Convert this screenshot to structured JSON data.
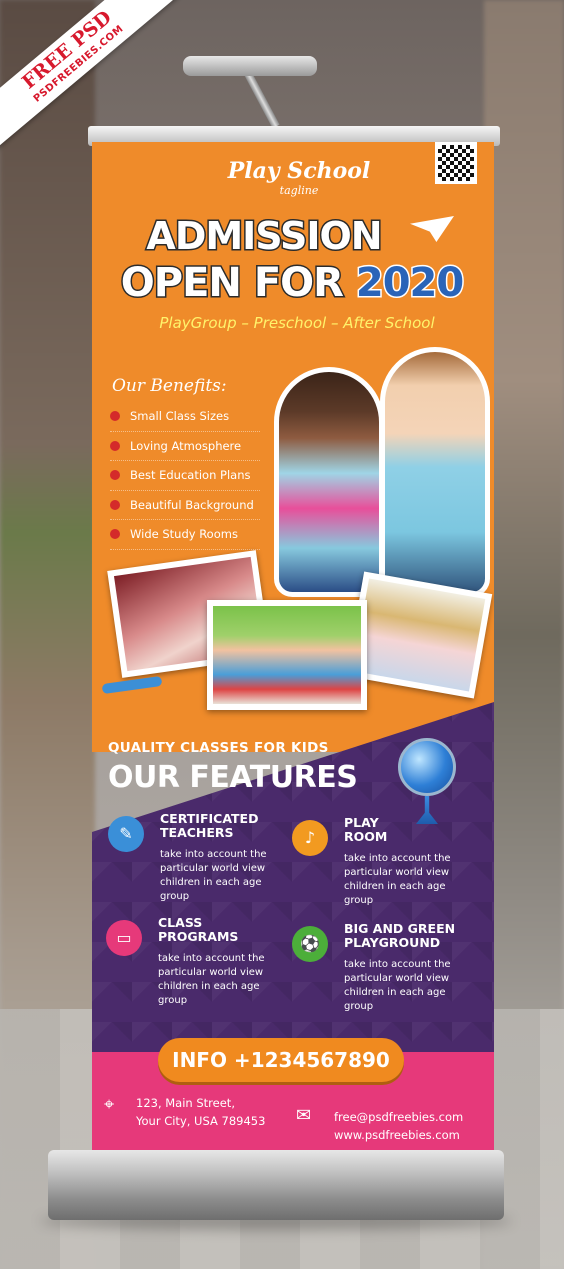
{
  "badge": {
    "title": "FREE PSD",
    "subtitle": "PSDFREEBIES.COM"
  },
  "brand": {
    "name": "Play School",
    "tagline": "tagline"
  },
  "headline": {
    "line1": "ADMISSION",
    "line2_a": "OPEN FOR",
    "line2_b": "2020"
  },
  "programs": "PlayGroup  –  Preschool  –  After School",
  "benefits": {
    "title": "Our Benefits:",
    "items": [
      "Small Class Sizes",
      "Loving Atmosphere",
      "Best Education Plans",
      "Beautiful Background",
      "Wide Study Rooms"
    ]
  },
  "features": {
    "kicker": "QUALITY CLASSES FOR KIDS",
    "title": "OUR FEATURES",
    "items": [
      {
        "title": "CERTIFICATED\nTEACHERS",
        "desc": "take into account the particular world view children in each age group",
        "icon": "pencil-icon",
        "color": "#3a8fd8"
      },
      {
        "title": "PLAY\nROOM",
        "desc": "take into account the particular world view children in each age group",
        "icon": "drum-icon",
        "color": "#f29a20"
      },
      {
        "title": "CLASS\nPROGRAMS",
        "desc": "take into account the particular world view children in each age group",
        "icon": "laptop-icon",
        "color": "#e6397a"
      },
      {
        "title": "BIG AND GREEN\nPLAYGROUND",
        "desc": "take into account the particular world view children in each age group",
        "icon": "ball-icon",
        "color": "#4cae3a"
      }
    ]
  },
  "info": "INFO +1234567890",
  "contact": {
    "address_line1": "123, Main Street,",
    "address_line2": "Your City, USA 789453",
    "email": "free@psdfreebies.com",
    "website": "www.psdfreebies.com"
  },
  "colors": {
    "orange": "#ef8b2a",
    "purple": "#4a2a6b",
    "pink": "#e6397a",
    "accent_yellow": "#fff36b",
    "badge_red": "#d7192d"
  }
}
